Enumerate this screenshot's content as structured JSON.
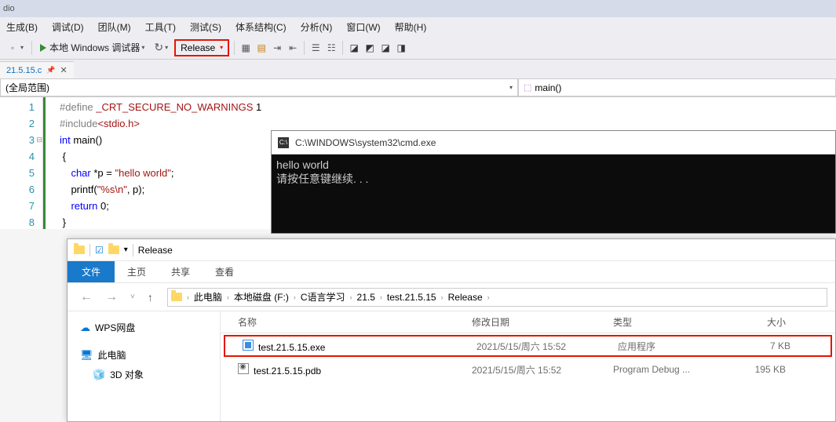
{
  "title_suffix": "dio",
  "menu": [
    "生成(B)",
    "调试(D)",
    "团队(M)",
    "工具(T)",
    "测试(S)",
    "体系结构(C)",
    "分析(N)",
    "窗口(W)",
    "帮助(H)"
  ],
  "toolbar": {
    "debugger_label": "本地 Windows 调试器",
    "config": "Release"
  },
  "tab": {
    "filename": "21.5.15.c"
  },
  "navbar": {
    "scope": "(全局范围)",
    "func": "main()"
  },
  "code": {
    "lines": [
      {
        "n": "1",
        "pre": "",
        "segs": [
          {
            "c": "kw-def",
            "t": "#define"
          },
          {
            "c": "",
            "t": " "
          },
          {
            "c": "kw-red",
            "t": "_CRT_SECURE_NO_WARNINGS"
          },
          {
            "c": "",
            "t": " 1"
          }
        ]
      },
      {
        "n": "2",
        "pre": "",
        "segs": [
          {
            "c": "kw-def",
            "t": "#include"
          },
          {
            "c": "kw-red",
            "t": "<stdio.h>"
          }
        ]
      },
      {
        "n": "3",
        "pre": "",
        "fold": "⊟",
        "segs": [
          {
            "c": "kw-blue",
            "t": "int"
          },
          {
            "c": "",
            "t": " main()"
          }
        ]
      },
      {
        "n": "4",
        "pre": " ",
        "segs": [
          {
            "c": "",
            "t": "{"
          }
        ]
      },
      {
        "n": "5",
        "pre": "    ",
        "segs": [
          {
            "c": "kw-blue",
            "t": "char"
          },
          {
            "c": "",
            "t": " *p = "
          },
          {
            "c": "kw-red",
            "t": "\"hello world\""
          },
          {
            "c": "",
            "t": ";"
          }
        ]
      },
      {
        "n": "6",
        "pre": "    ",
        "segs": [
          {
            "c": "",
            "t": "printf("
          },
          {
            "c": "kw-red",
            "t": "\"%s\\n\""
          },
          {
            "c": "",
            "t": ", p);"
          }
        ]
      },
      {
        "n": "7",
        "pre": "    ",
        "segs": [
          {
            "c": "kw-blue",
            "t": "return"
          },
          {
            "c": "",
            "t": " 0;"
          }
        ]
      },
      {
        "n": "8",
        "pre": " ",
        "segs": [
          {
            "c": "",
            "t": "}"
          }
        ]
      }
    ]
  },
  "cmd": {
    "title": "C:\\WINDOWS\\system32\\cmd.exe",
    "line1": "hello world",
    "line2": "请按任意键继续. . ."
  },
  "explorer": {
    "title": "Release",
    "ribbon": {
      "file": "文件",
      "tabs": [
        "主页",
        "共享",
        "查看"
      ]
    },
    "breadcrumb": [
      "此电脑",
      "本地磁盘 (F:)",
      "C语言学习",
      "21.5",
      "test.21.5.15",
      "Release"
    ],
    "sidebar": {
      "wps": "WPS网盘",
      "pc": "此电脑",
      "obj": "3D 对象"
    },
    "columns": {
      "name": "名称",
      "date": "修改日期",
      "type": "类型",
      "size": "大小"
    },
    "rows": [
      {
        "name": "test.21.5.15.exe",
        "date": "2021/5/15/周六 15:52",
        "type": "应用程序",
        "size": "7 KB",
        "icon": "exe",
        "hl": true
      },
      {
        "name": "test.21.5.15.pdb",
        "date": "2021/5/15/周六 15:52",
        "type": "Program Debug ...",
        "size": "195 KB",
        "icon": "pdb",
        "hl": false
      }
    ]
  }
}
